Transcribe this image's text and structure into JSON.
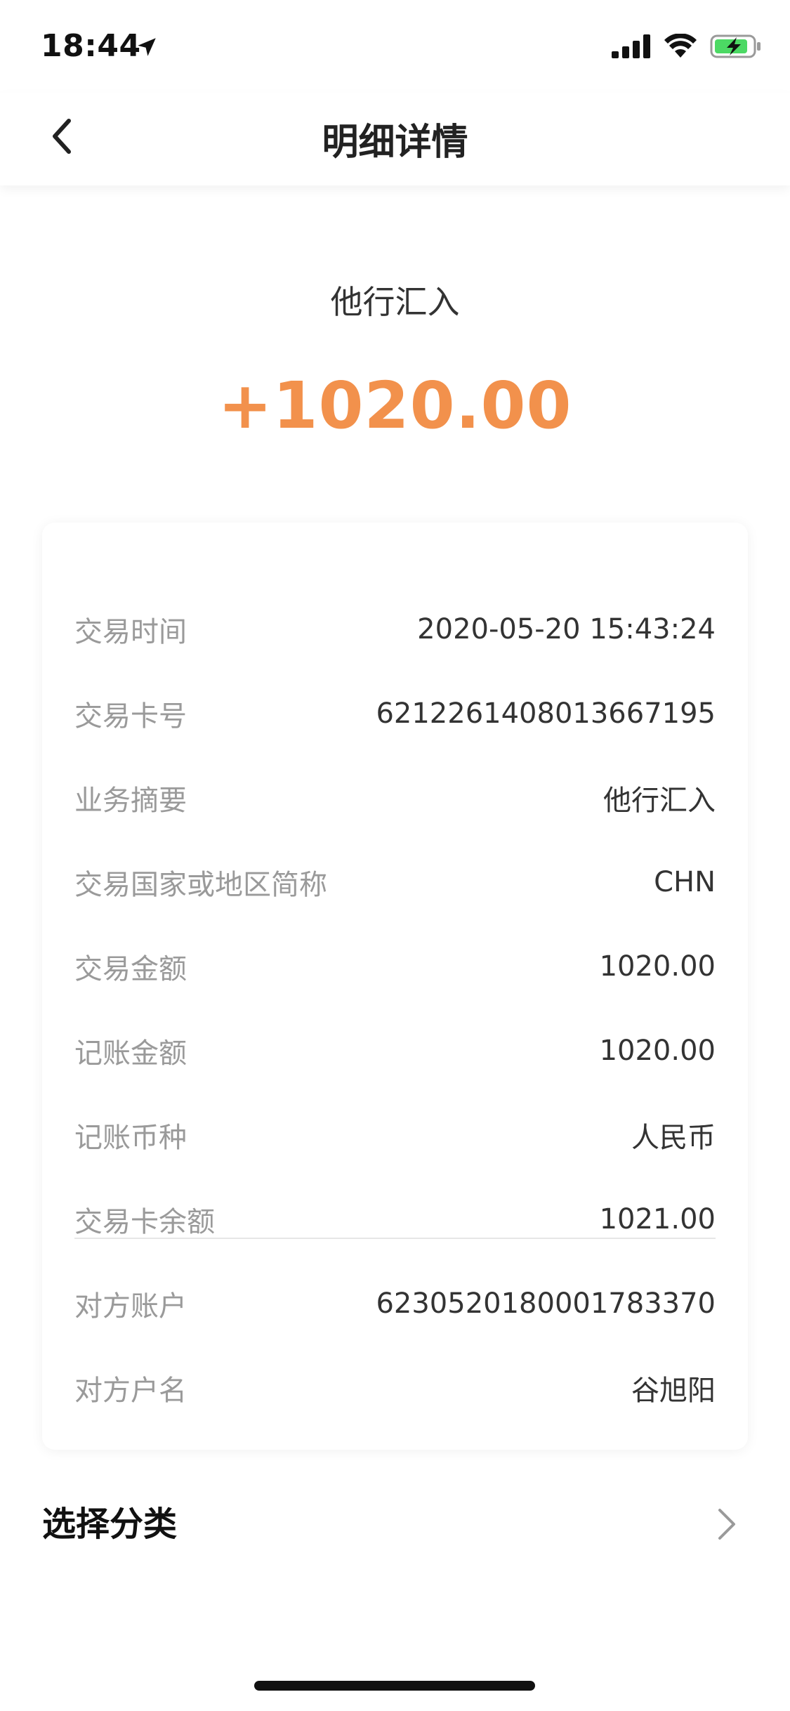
{
  "status_bar": {
    "time": "18:44",
    "icons": [
      "location-arrow-icon",
      "cellular-signal-icon",
      "wifi-icon",
      "battery-charging-icon"
    ],
    "battery_color": "#4cd964"
  },
  "nav": {
    "title": "明细详情",
    "back_icon": "chevron-left-icon"
  },
  "header": {
    "transaction_type": "他行汇入",
    "amount": "+1020.00",
    "amount_color": "#f2914c"
  },
  "details": {
    "rows": [
      {
        "label": "交易时间",
        "value": "2020-05-20 15:43:24"
      },
      {
        "label": "交易卡号",
        "value": "6212261408013667195"
      },
      {
        "label": "业务摘要",
        "value": "他行汇入"
      },
      {
        "label": "交易国家或地区简称",
        "value": "CHN"
      },
      {
        "label": "交易金额",
        "value": "1020.00"
      },
      {
        "label": "记账金额",
        "value": "1020.00"
      },
      {
        "label": "记账币种",
        "value": "人民币"
      },
      {
        "label": "交易卡余额",
        "value": "1021.00"
      },
      {
        "label": "对方账户",
        "value": "6230520180001783370"
      },
      {
        "label": "对方户名",
        "value": "谷旭阳"
      }
    ]
  },
  "category": {
    "label": "选择分类",
    "chevron_icon": "chevron-right-icon"
  }
}
